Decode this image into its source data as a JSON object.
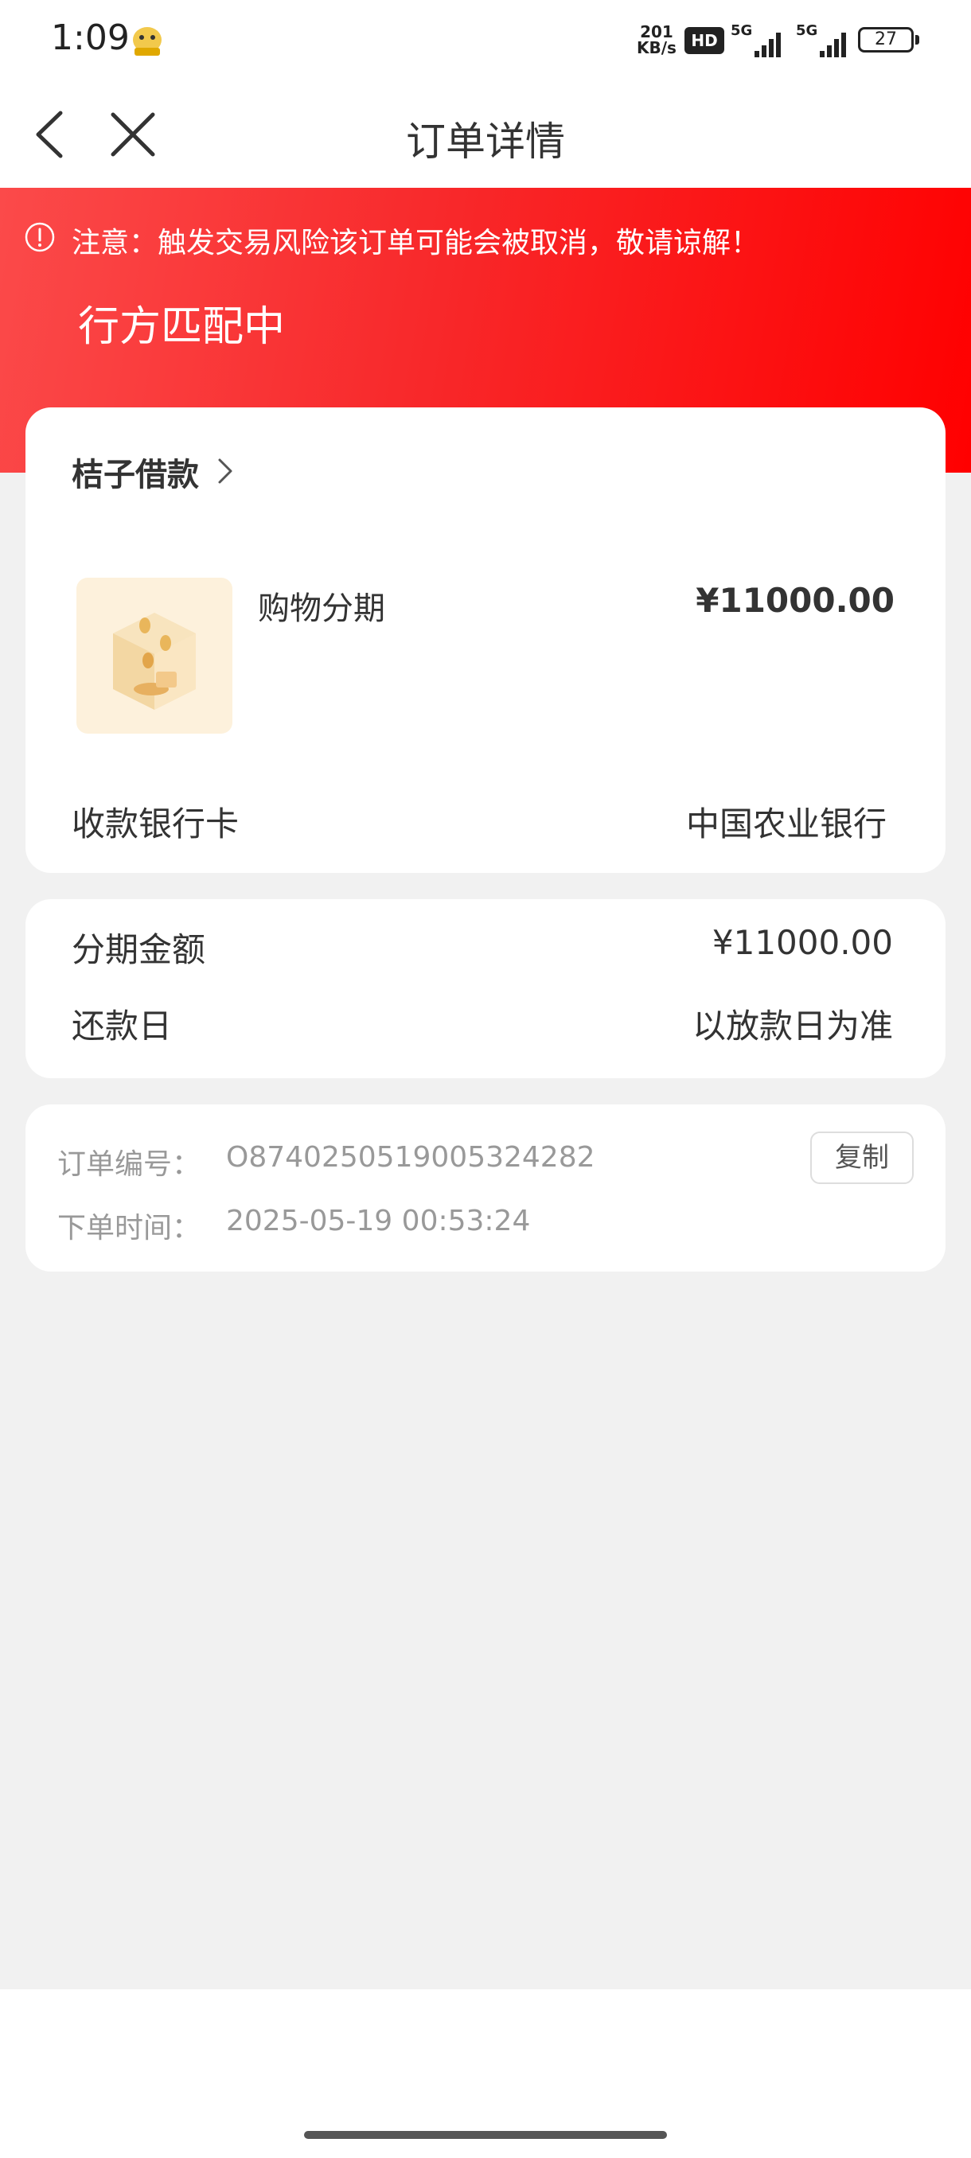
{
  "status_bar": {
    "time": "1:09",
    "net_speed_value": "201",
    "net_speed_unit": "KB/s",
    "hd_badge": "HD",
    "signal1_type": "5G",
    "signal2_type": "5G",
    "battery": "27"
  },
  "nav": {
    "title": "订单详情"
  },
  "hero": {
    "warning": "注意：触发交易风险该订单可能会被取消，敬请谅解！",
    "status": "行方匹配中",
    "accent_color": "#ff0000"
  },
  "order_card": {
    "lender_name": "桔子借款",
    "product_name": "购物分期",
    "product_amount": "¥11000.00",
    "bank_label": "收款银行卡",
    "bank_value": "中国农业银行"
  },
  "installment_card": {
    "amount_label": "分期金额",
    "amount_value": "¥11000.00",
    "repay_label": "还款日",
    "repay_value": "以放款日为准"
  },
  "info_card": {
    "order_no_label": "订单编号：",
    "order_no_value": "O874025051900532428​2",
    "order_time_label": "下单时间：",
    "order_time_value": "2025-05-19 00:53:24",
    "copy_label": "复制"
  }
}
